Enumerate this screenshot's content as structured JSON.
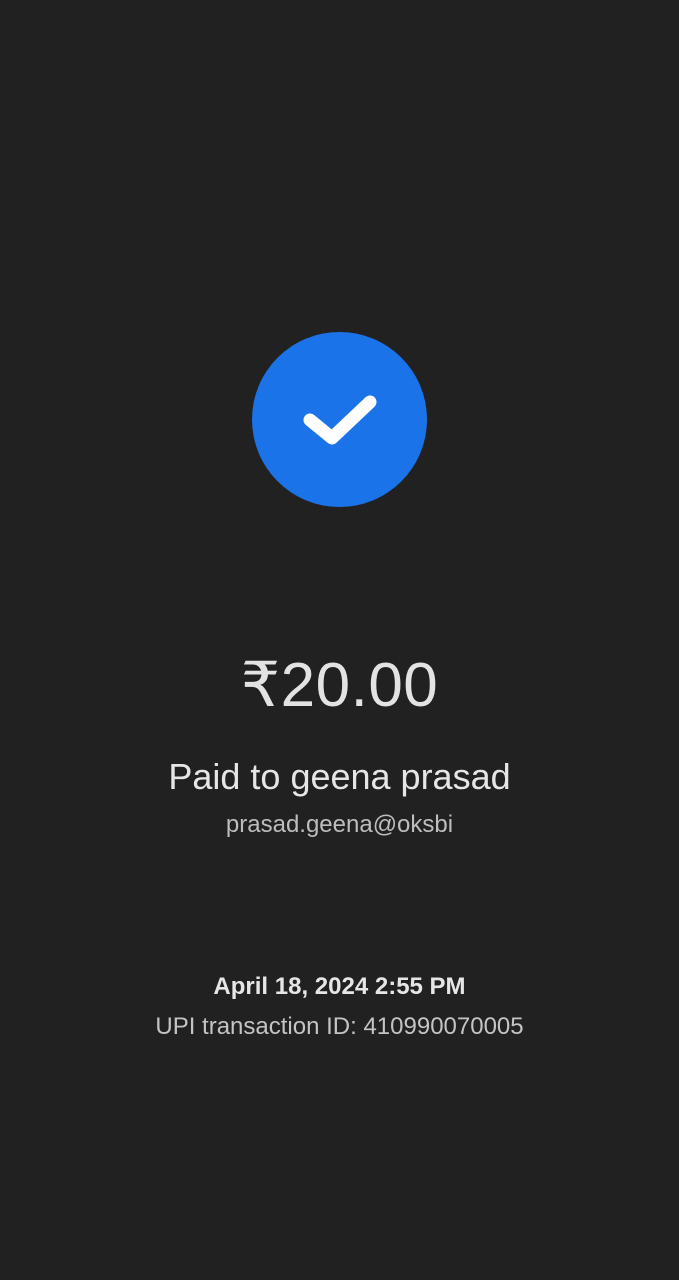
{
  "status": {
    "icon": "check-icon",
    "badge_color": "#1a73e8"
  },
  "payment": {
    "amount": "₹20.00",
    "payee_line": "Paid to geena prasad",
    "payee_vpa": "prasad.geena@oksbi"
  },
  "transaction": {
    "datetime": "April 18, 2024 2:55 PM",
    "upi_id_line": "UPI transaction ID: 410990070005"
  },
  "theme": {
    "background": "#212121",
    "text_primary": "#e6e6e6",
    "text_secondary": "#bdbdbd"
  }
}
